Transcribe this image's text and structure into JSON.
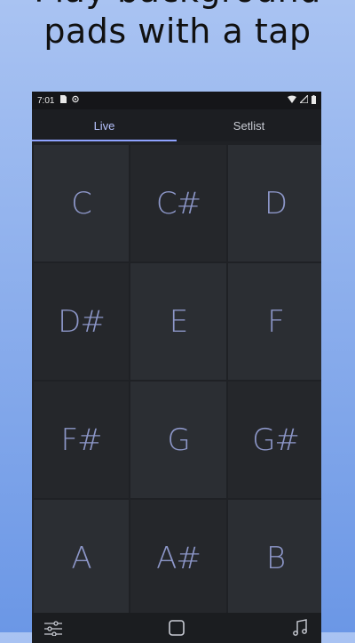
{
  "headline": {
    "line1": "Play background",
    "line2": "pads with a tap"
  },
  "status_bar": {
    "time": "7:01"
  },
  "tabs": [
    {
      "label": "Live",
      "active": true
    },
    {
      "label": "Setlist",
      "active": false
    }
  ],
  "pads": [
    {
      "note": "C"
    },
    {
      "note": "C#"
    },
    {
      "note": "D"
    },
    {
      "note": "D#"
    },
    {
      "note": "E"
    },
    {
      "note": "F"
    },
    {
      "note": "F#"
    },
    {
      "note": "G"
    },
    {
      "note": "G#"
    },
    {
      "note": "A"
    },
    {
      "note": "A#"
    },
    {
      "note": "B"
    }
  ],
  "bottom_bar": {
    "left_icon": "sliders-icon",
    "center_icon": "square-icon",
    "right_icon": "music-note-icon"
  },
  "colors": {
    "background_top": "#a9c3f2",
    "background_bottom": "#6b97e6",
    "pad": "#2b2e33",
    "pad_text": "#8d97c9",
    "tab_accent": "#8ea2ff"
  }
}
